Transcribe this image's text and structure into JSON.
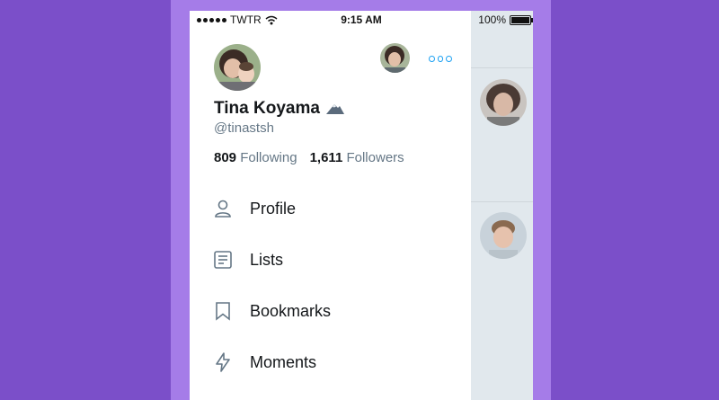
{
  "status_bar": {
    "carrier": "TWTR",
    "time": "9:15 AM",
    "battery": "100%"
  },
  "profile": {
    "name": "Tina Koyama",
    "handle": "@tinastsh",
    "following_count": "809",
    "following_label": "Following",
    "followers_count": "1,611",
    "followers_label": "Followers"
  },
  "menu": {
    "items": [
      {
        "label": "Profile",
        "icon": "person-icon"
      },
      {
        "label": "Lists",
        "icon": "list-icon"
      },
      {
        "label": "Bookmarks",
        "icon": "bookmark-icon"
      },
      {
        "label": "Moments",
        "icon": "lightning-icon"
      }
    ]
  },
  "colors": {
    "accent": "#1da1f2",
    "background": "#7b4fc9",
    "frame": "#a57ce8",
    "text_secondary": "#657786"
  }
}
